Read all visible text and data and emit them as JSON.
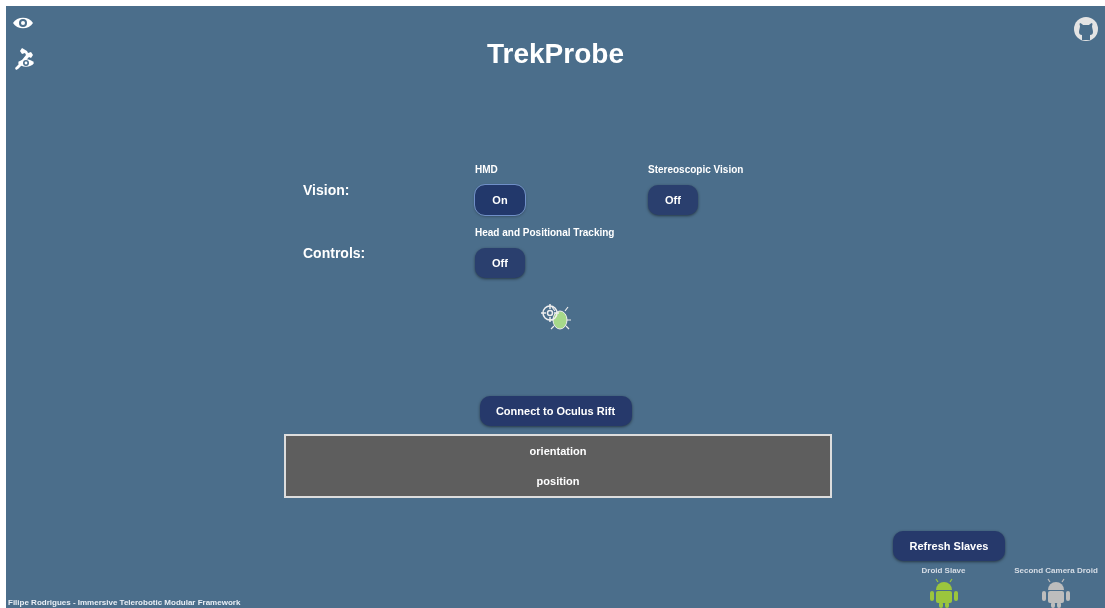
{
  "title": "TrekProbe",
  "settings": [
    {
      "label": "Vision:",
      "options": [
        {
          "label": "HMD",
          "on": true,
          "value": "On"
        },
        {
          "label": "Stereoscopic Vision",
          "on": false,
          "value": "Off"
        }
      ]
    },
    {
      "label": "Controls:",
      "options": [
        {
          "label": "Head and Positional Tracking",
          "on": false,
          "value": "Off"
        }
      ]
    }
  ],
  "connect_button": "Connect to Oculus Rift",
  "readout": [
    "orientation",
    "position"
  ],
  "refresh_button": "Refresh Slaves",
  "slaves": [
    {
      "name": "Droid Slave",
      "connected": true
    },
    {
      "name": "Second Camera Droid",
      "connected": false
    }
  ],
  "footer": "Filipe Rodrigues - Immersive Telerobotic Modular Framework"
}
